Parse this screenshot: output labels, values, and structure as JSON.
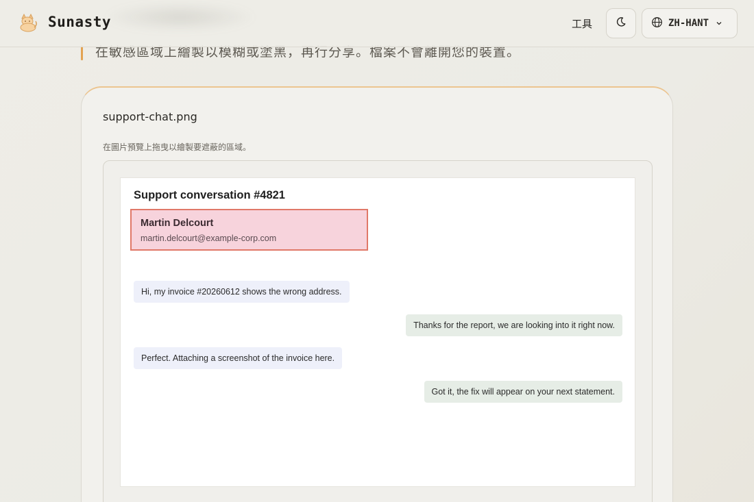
{
  "header": {
    "brand": "Sunasty",
    "nav_tools": "工具",
    "language": "ZH-HANT",
    "icons": {
      "logo": "cat-logo-icon",
      "theme": "moon-icon",
      "lang": "globe-icon",
      "chevron": "chevron-down-icon"
    }
  },
  "intro": {
    "description": "在敏感區域上繪製以模糊或塗黑，再行分享。檔案不會離開您的裝置。"
  },
  "editor": {
    "file_name": "support-chat.png",
    "hint": "在圖片預覽上拖曳以繪製要遮蔽的區域。"
  },
  "screenshot": {
    "title": "Support conversation #4821",
    "redacted": {
      "name": "Martin Delcourt",
      "email": "martin.delcourt@example-corp.com"
    },
    "messages": [
      {
        "side": "incoming",
        "text": "Hi, my invoice #20260612 shows the wrong address."
      },
      {
        "side": "outgoing",
        "text": "Thanks for the report, we are looking into it right now."
      },
      {
        "side": "incoming",
        "text": "Perfect. Attaching a screenshot of the invoice here."
      },
      {
        "side": "outgoing",
        "text": "Got it, the fix will appear on your next statement."
      }
    ]
  },
  "colors": {
    "accent": "#e3a352",
    "redaction_fill": "#e6789655",
    "redaction_border": "#e07868"
  }
}
